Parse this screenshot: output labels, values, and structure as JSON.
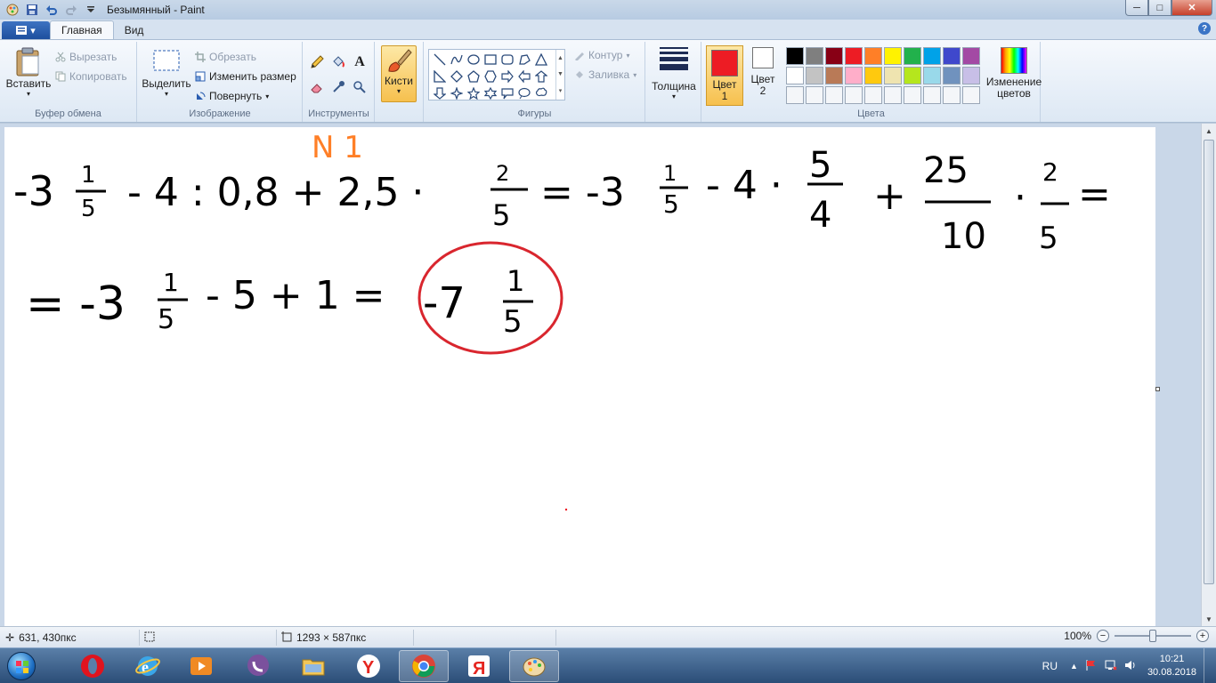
{
  "window": {
    "title": "Безымянный - Paint",
    "buttons": {
      "minimize": "─",
      "maximize": "□",
      "close": "✕"
    }
  },
  "tabs": [
    {
      "label": "Главная",
      "active": true
    },
    {
      "label": "Вид",
      "active": false
    }
  ],
  "help": "?",
  "ribbon": {
    "clipboard": {
      "label": "Буфер обмена",
      "paste": "Вставить",
      "cut": "Вырезать",
      "copy": "Копировать"
    },
    "image": {
      "label": "Изображение",
      "select": "Выделить",
      "crop": "Обрезать",
      "resize": "Изменить размер",
      "rotate": "Повернуть"
    },
    "tools": {
      "label": "Инструменты",
      "text_tool": "A"
    },
    "brushes": {
      "label": "Кисти"
    },
    "shapes": {
      "label": "Фигуры",
      "outline": "Контур",
      "fill": "Заливка"
    },
    "size": {
      "label": "Толщина"
    },
    "colors": {
      "label": "Цвета",
      "color1": "Цвет 1",
      "color2": "Цвет 2",
      "color1_value": "#ed1c24",
      "color2_value": "#ffffff",
      "edit": "Изменение цветов",
      "palette": [
        "#000000",
        "#7f7f7f",
        "#880015",
        "#ed1c24",
        "#ff7f27",
        "#fff200",
        "#22b14c",
        "#00a2e8",
        "#3f48cc",
        "#a349a4",
        "#ffffff",
        "#c3c3c3",
        "#b97a57",
        "#ffaec9",
        "#ffc90e",
        "#efe4b0",
        "#b5e61d",
        "#99d9ea",
        "#7092be",
        "#c8bfe7",
        "#f4f6f9",
        "#f4f6f9",
        "#f4f6f9",
        "#f4f6f9",
        "#f4f6f9",
        "#f4f6f9",
        "#f4f6f9",
        "#f4f6f9",
        "#f4f6f9",
        "#f4f6f9"
      ]
    }
  },
  "canvas": {
    "heading": "N 1",
    "line1": [
      {
        "id": "n1",
        "text": "-3"
      },
      {
        "id": "f1n",
        "text": "1"
      },
      {
        "id": "f1d",
        "text": "5"
      },
      {
        "id": "t2",
        "text": "- 4 : 0,8 + 2,5 ·"
      },
      {
        "id": "f2n",
        "text": "2"
      },
      {
        "id": "f2d",
        "text": "5"
      },
      {
        "id": "t3",
        "text": "= -3"
      },
      {
        "id": "f3n",
        "text": "1"
      },
      {
        "id": "f3d",
        "text": "5"
      },
      {
        "id": "t4",
        "text": "- 4 ·"
      },
      {
        "id": "f4n",
        "text": "5"
      },
      {
        "id": "f4d",
        "text": "4"
      },
      {
        "id": "t5",
        "text": "+"
      },
      {
        "id": "f5n",
        "text": "25"
      },
      {
        "id": "f5d",
        "text": "10"
      },
      {
        "id": "t6",
        "text": "·"
      },
      {
        "id": "f6n",
        "text": "2"
      },
      {
        "id": "f6d",
        "text": "5"
      },
      {
        "id": "t7",
        "text": "="
      }
    ],
    "line2": [
      {
        "id": "s1",
        "text": "= -3"
      },
      {
        "id": "g1n",
        "text": "1"
      },
      {
        "id": "g1d",
        "text": "5"
      },
      {
        "id": "s2",
        "text": "- 5 + 1 ="
      },
      {
        "id": "s3",
        "text": "-7"
      },
      {
        "id": "g2n",
        "text": "1"
      },
      {
        "id": "g2d",
        "text": "5"
      }
    ]
  },
  "status": {
    "cursor": "631, 430пкс",
    "selection": "",
    "size": "1293 × 587пкс",
    "zoom": "100%",
    "zoom_value": 100
  },
  "taskbar": {
    "apps": [
      "Opera",
      "Internet Explorer",
      "Media Player",
      "Viber",
      "Explorer",
      "Yandex",
      "Chrome",
      "Яндекс",
      "Paint"
    ],
    "active_app": "Paint",
    "yandex_label": "Я",
    "lang": "RU",
    "time": "10:21",
    "date": "30.08.2018"
  }
}
